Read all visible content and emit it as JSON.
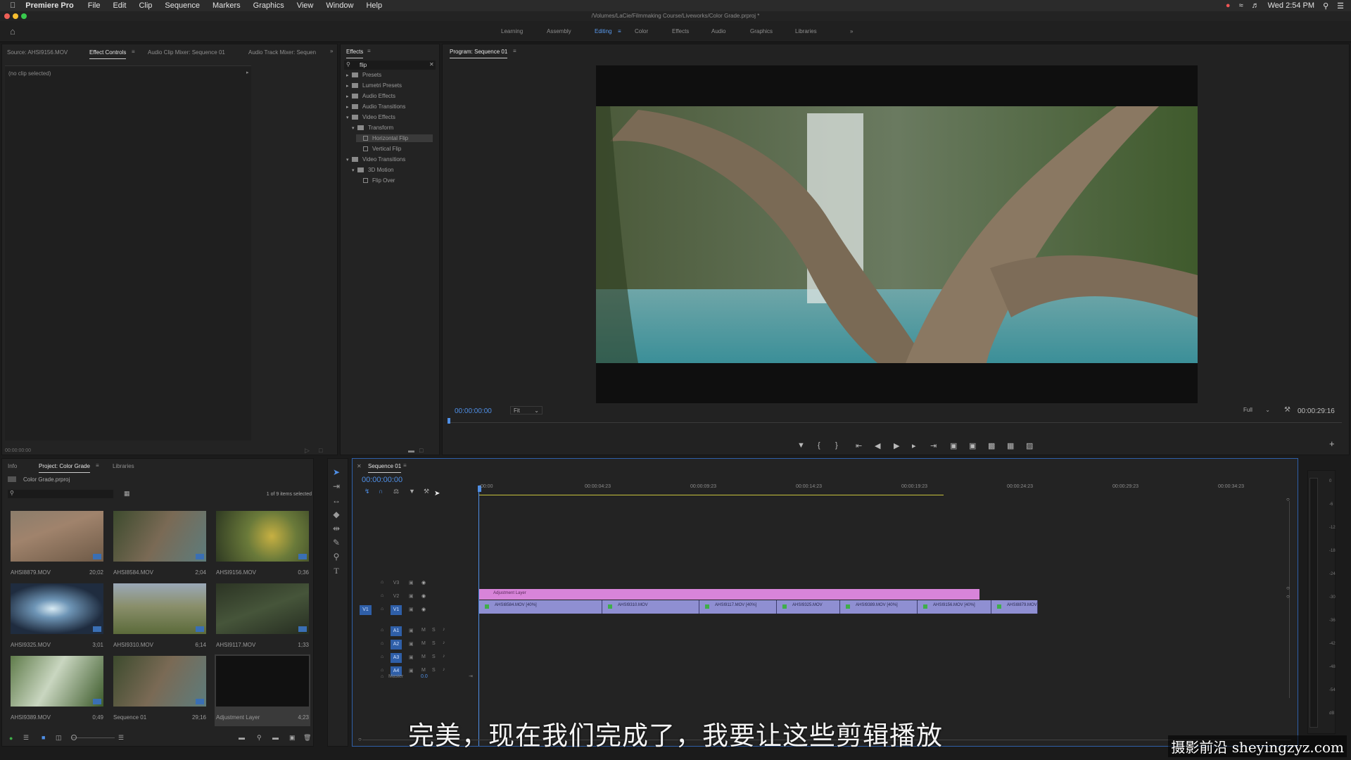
{
  "menubar": {
    "app": "Premiere Pro",
    "items": [
      "File",
      "Edit",
      "Clip",
      "Sequence",
      "Markers",
      "Graphics",
      "View",
      "Window",
      "Help"
    ],
    "clock": "Wed 2:54 PM"
  },
  "window": {
    "title": "/Volumes/LaCie/Filmmaking Course/Liveworks/Color Grade.prproj *"
  },
  "workspaces": {
    "items": [
      "Learning",
      "Assembly",
      "Editing",
      "Color",
      "Effects",
      "Audio",
      "Graphics",
      "Libraries"
    ],
    "active": "Editing",
    "more": "»"
  },
  "source_panel": {
    "tabs": [
      "Source: AHSI9156.MOV",
      "Effect Controls",
      "Audio Clip Mixer: Sequence 01",
      "Audio Track Mixer: Sequen"
    ],
    "active_tab": "Effect Controls",
    "more": "»",
    "no_clip": "(no clip selected)",
    "timecode": "00:00:00:00"
  },
  "effects_panel": {
    "title": "Effects",
    "search_value": "flip",
    "tree": [
      {
        "label": "Presets",
        "type": "folder",
        "depth": 0
      },
      {
        "label": "Lumetri Presets",
        "type": "folder",
        "depth": 0
      },
      {
        "label": "Audio Effects",
        "type": "folder",
        "depth": 0
      },
      {
        "label": "Audio Transitions",
        "type": "folder",
        "depth": 0
      },
      {
        "label": "Video Effects",
        "type": "folder",
        "depth": 0,
        "open": true
      },
      {
        "label": "Transform",
        "type": "folder",
        "depth": 1,
        "open": true
      },
      {
        "label": "Horizontal Flip",
        "type": "effect",
        "depth": 2,
        "selected": true
      },
      {
        "label": "Vertical Flip",
        "type": "effect",
        "depth": 2
      },
      {
        "label": "Video Transitions",
        "type": "folder",
        "depth": 0,
        "open": true
      },
      {
        "label": "3D Motion",
        "type": "folder",
        "depth": 1,
        "open": true
      },
      {
        "label": "Flip Over",
        "type": "effect",
        "depth": 2
      }
    ]
  },
  "program": {
    "title": "Program: Sequence 01",
    "timecode": "00:00:00:00",
    "fit": "Fit",
    "quality": "Full",
    "duration": "00:00:29:16"
  },
  "project": {
    "tabs": [
      "Info",
      "Project: Color Grade",
      "Libraries"
    ],
    "active_tab": "Project: Color Grade",
    "file": "Color Grade.prproj",
    "selection": "1 of 9 items selected",
    "items": [
      {
        "name": "AHSI8879.MOV",
        "duration": "20;02",
        "thumb": "person"
      },
      {
        "name": "AHSI8584.MOV",
        "duration": "2;04",
        "thumb": "branch"
      },
      {
        "name": "AHSI9156.MOV",
        "duration": "0;36",
        "thumb": "leaf"
      },
      {
        "name": "AHSI9325.MOV",
        "duration": "3;01",
        "thumb": "waterfall"
      },
      {
        "name": "AHSI9310.MOV",
        "duration": "6;14",
        "thumb": "cow"
      },
      {
        "name": "AHSI9117.MOV",
        "duration": "1;33",
        "thumb": "forest"
      },
      {
        "name": "AHSI9389.MOV",
        "duration": "0;49",
        "thumb": "moss"
      },
      {
        "name": "Sequence 01",
        "duration": "29;16",
        "thumb": "branch"
      },
      {
        "name": "Adjustment Layer",
        "duration": "4;23",
        "thumb": "black"
      }
    ]
  },
  "timeline": {
    "tab": "Sequence 01",
    "timecode": "00:00:00:00",
    "ruler": [
      ":00:00",
      "00:00:04:23",
      "00:00:09:23",
      "00:00:14:23",
      "00:00:19:23",
      "00:00:24:23",
      "00:00:29:23",
      "00:00:34:23"
    ],
    "video_tracks": [
      "V3",
      "V2",
      "V1"
    ],
    "audio_tracks": [
      "A1",
      "A2",
      "A3",
      "A4"
    ],
    "source_patch_v": "V1",
    "master": "Master",
    "master_value": "0.0",
    "adjustment_clip": "Adjustment Layer",
    "clips": [
      "AHSI8584.MOV [40%]",
      "AHSI9310.MOV",
      "AHSI9117.MOV [40%]",
      "AHSI9325.MOV",
      "AHSI9389.MOV [40%]",
      "AHSI9156.MOV [40%]",
      "AHSI8879.MOV"
    ]
  },
  "meter_ticks": [
    "0",
    "-6",
    "-12",
    "-18",
    "-24",
    "-30",
    "-36",
    "-42",
    "-48",
    "-54",
    "dB"
  ],
  "subtitle": "完美，现在我们完成了，我要让这些剪辑播放",
  "watermark": "摄影前沿 sheyingzyz.com"
}
